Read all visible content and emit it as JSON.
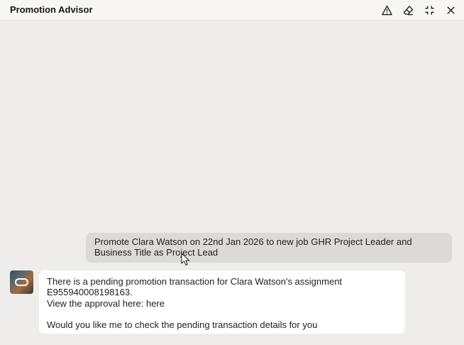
{
  "window": {
    "title": "Promotion Advisor",
    "icons": [
      "warning-icon",
      "eraser-icon",
      "collapse-icon",
      "close-icon"
    ]
  },
  "chat": {
    "user_message": "Promote Clara Watson on 22nd Jan 2026 to new job GHR Project Leader and Business Title as Project Lead",
    "bot_message": {
      "line1": "There is a pending promotion transaction for Clara Watson's assignment",
      "line2": "E955940008198163.",
      "line3_prefix": "View the approval here: ",
      "line3_link": "here",
      "line4": "Would you like me to check the pending transaction details for you"
    }
  },
  "colors": {
    "background": "#eeedeb",
    "user_bubble": "#dcdad7",
    "bot_bubble": "#ffffff"
  }
}
